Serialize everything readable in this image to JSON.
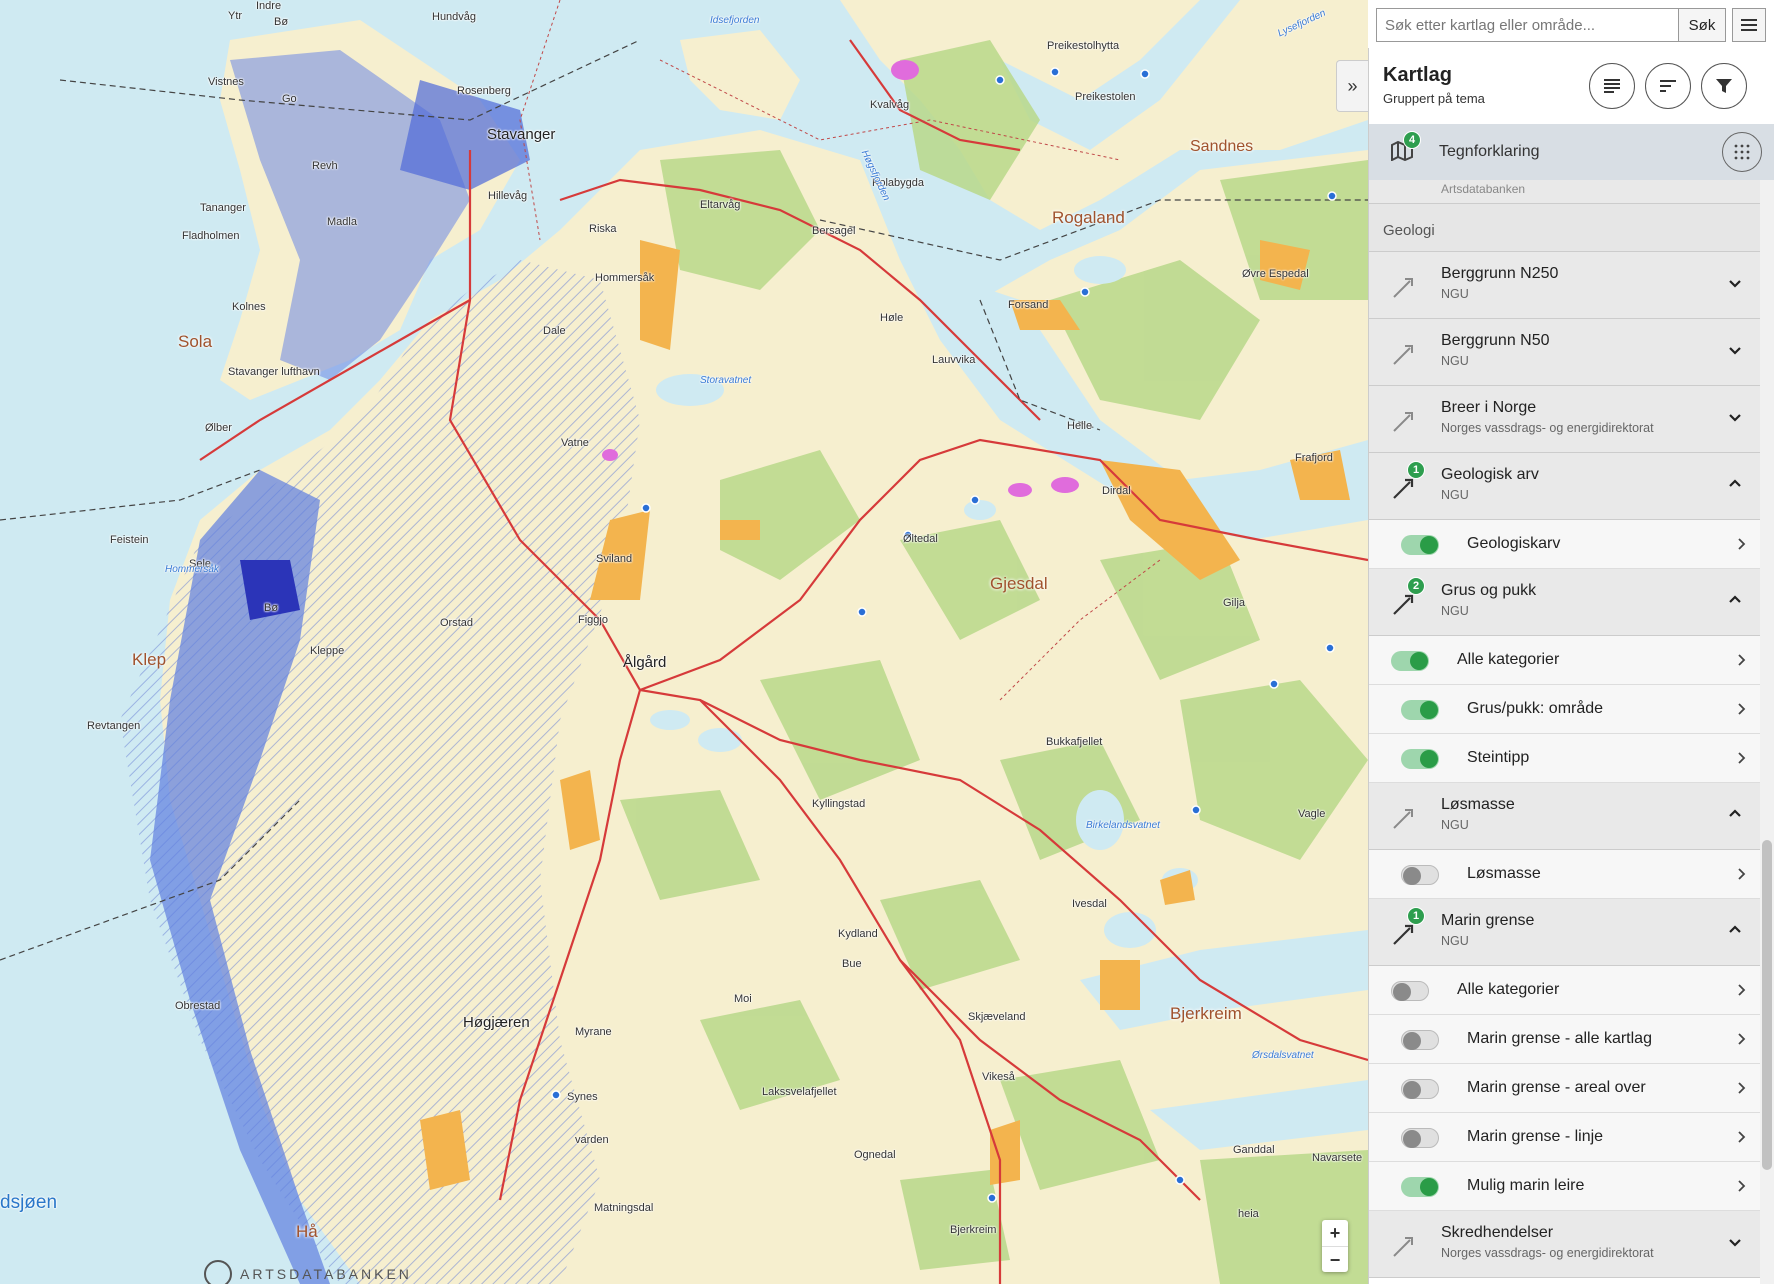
{
  "search": {
    "placeholder": "Søk etter kartlag eller område...",
    "button": "Søk"
  },
  "panel": {
    "title": "Kartlag",
    "subtitle": "Gruppert på tema",
    "legend": {
      "label": "Tegnforklaring",
      "count": "4"
    },
    "cut_text": "Artsdatabanken",
    "section": "Geologi",
    "layers": [
      {
        "title": "Berggrunn N250",
        "source": "NGU",
        "expanded": false,
        "badge": ""
      },
      {
        "title": "Berggrunn N50",
        "source": "NGU",
        "expanded": false,
        "badge": ""
      },
      {
        "title": "Breer i Norge",
        "source": "Norges vassdrags- og energidirektorat",
        "expanded": false,
        "badge": ""
      },
      {
        "title": "Geologisk arv",
        "source": "NGU",
        "expanded": true,
        "badge": "1",
        "children": [
          {
            "label": "Geologiskarv",
            "on": true,
            "level": 1
          }
        ]
      },
      {
        "title": "Grus og pukk",
        "source": "NGU",
        "expanded": true,
        "badge": "2",
        "children": [
          {
            "label": "Alle kategorier",
            "on": true,
            "level": 0
          },
          {
            "label": "Grus/pukk: område",
            "on": true,
            "level": 1
          },
          {
            "label": "Steintipp",
            "on": true,
            "level": 1
          }
        ]
      },
      {
        "title": "Løsmasse",
        "source": "NGU",
        "expanded": true,
        "badge": "",
        "children": [
          {
            "label": "Løsmasse",
            "on": false,
            "level": 1
          }
        ]
      },
      {
        "title": "Marin grense",
        "source": "NGU",
        "expanded": true,
        "badge": "1",
        "children": [
          {
            "label": "Alle kategorier",
            "on": false,
            "level": 0
          },
          {
            "label": "Marin grense - alle kartlag",
            "on": false,
            "level": 1
          },
          {
            "label": "Marin grense - areal over",
            "on": false,
            "level": 1
          },
          {
            "label": "Marin grense - linje",
            "on": false,
            "level": 1
          },
          {
            "label": "Mulig marin leire",
            "on": true,
            "level": 1
          }
        ]
      },
      {
        "title": "Skredhendelser",
        "source": "Norges vassdrags- og energidirektorat",
        "expanded": false,
        "badge": ""
      }
    ]
  },
  "map": {
    "zoom_in": "+",
    "zoom_out": "−",
    "attribution": "ARTSDATABANKEN",
    "places": {
      "regions": [
        "Rogaland",
        "Gjesdal",
        "Bjerkreim",
        "Sandnes",
        "Sola",
        "Klep",
        "Hå"
      ],
      "cities": [
        "Stavanger",
        "Høgjæren"
      ],
      "towns": [
        "Ytr",
        "Indre",
        "Bø",
        "Hundvåg",
        "Vistnes",
        "Rosenberg",
        "Go",
        "Revh",
        "Tananger",
        "Hillevåg",
        "Madla",
        "Fladholmen",
        "Kolnes",
        "Stavanger lufthavn",
        "Ølber",
        "Feistein",
        "Sele",
        "Bø",
        "Revtangen",
        "Kleppe",
        "Orstad",
        "Ålgård",
        "Figgjo",
        "Kyllingstad",
        "Kydland",
        "Bue",
        "Moi",
        "Skjæveland",
        "Vikeså",
        "Lakssvelafjellet",
        "Ognedal",
        "Matningsdal",
        "Myrane",
        "Synes",
        "varden",
        "Obrestad",
        "Øltedal",
        "Bukkafjellet",
        "Ivesdal",
        "Gilja",
        "Helle",
        "Dirdal",
        "Frafjord",
        "Øvre Espedal",
        "Forsand",
        "Lauvvika",
        "Høle",
        "Bersagel",
        "Eltarvåg",
        "Kolabygda",
        "Kvalvåg",
        "Preikestolhytta",
        "Preikestolen",
        "Riska",
        "Hommersåk",
        "Dale",
        "Vatne",
        "Sviland",
        "Bjerkreim",
        "Navarsete",
        "Vagle",
        "heia",
        "Ganddal"
      ],
      "waters": [
        "Idsefjorden",
        "Høgsfjorden",
        "Lysefjorden",
        "Storavatnet",
        "Hommersåk",
        "Birkelandsvatnet",
        "Ørsdalsvatnet"
      ],
      "sea": "dsjøen"
    }
  }
}
